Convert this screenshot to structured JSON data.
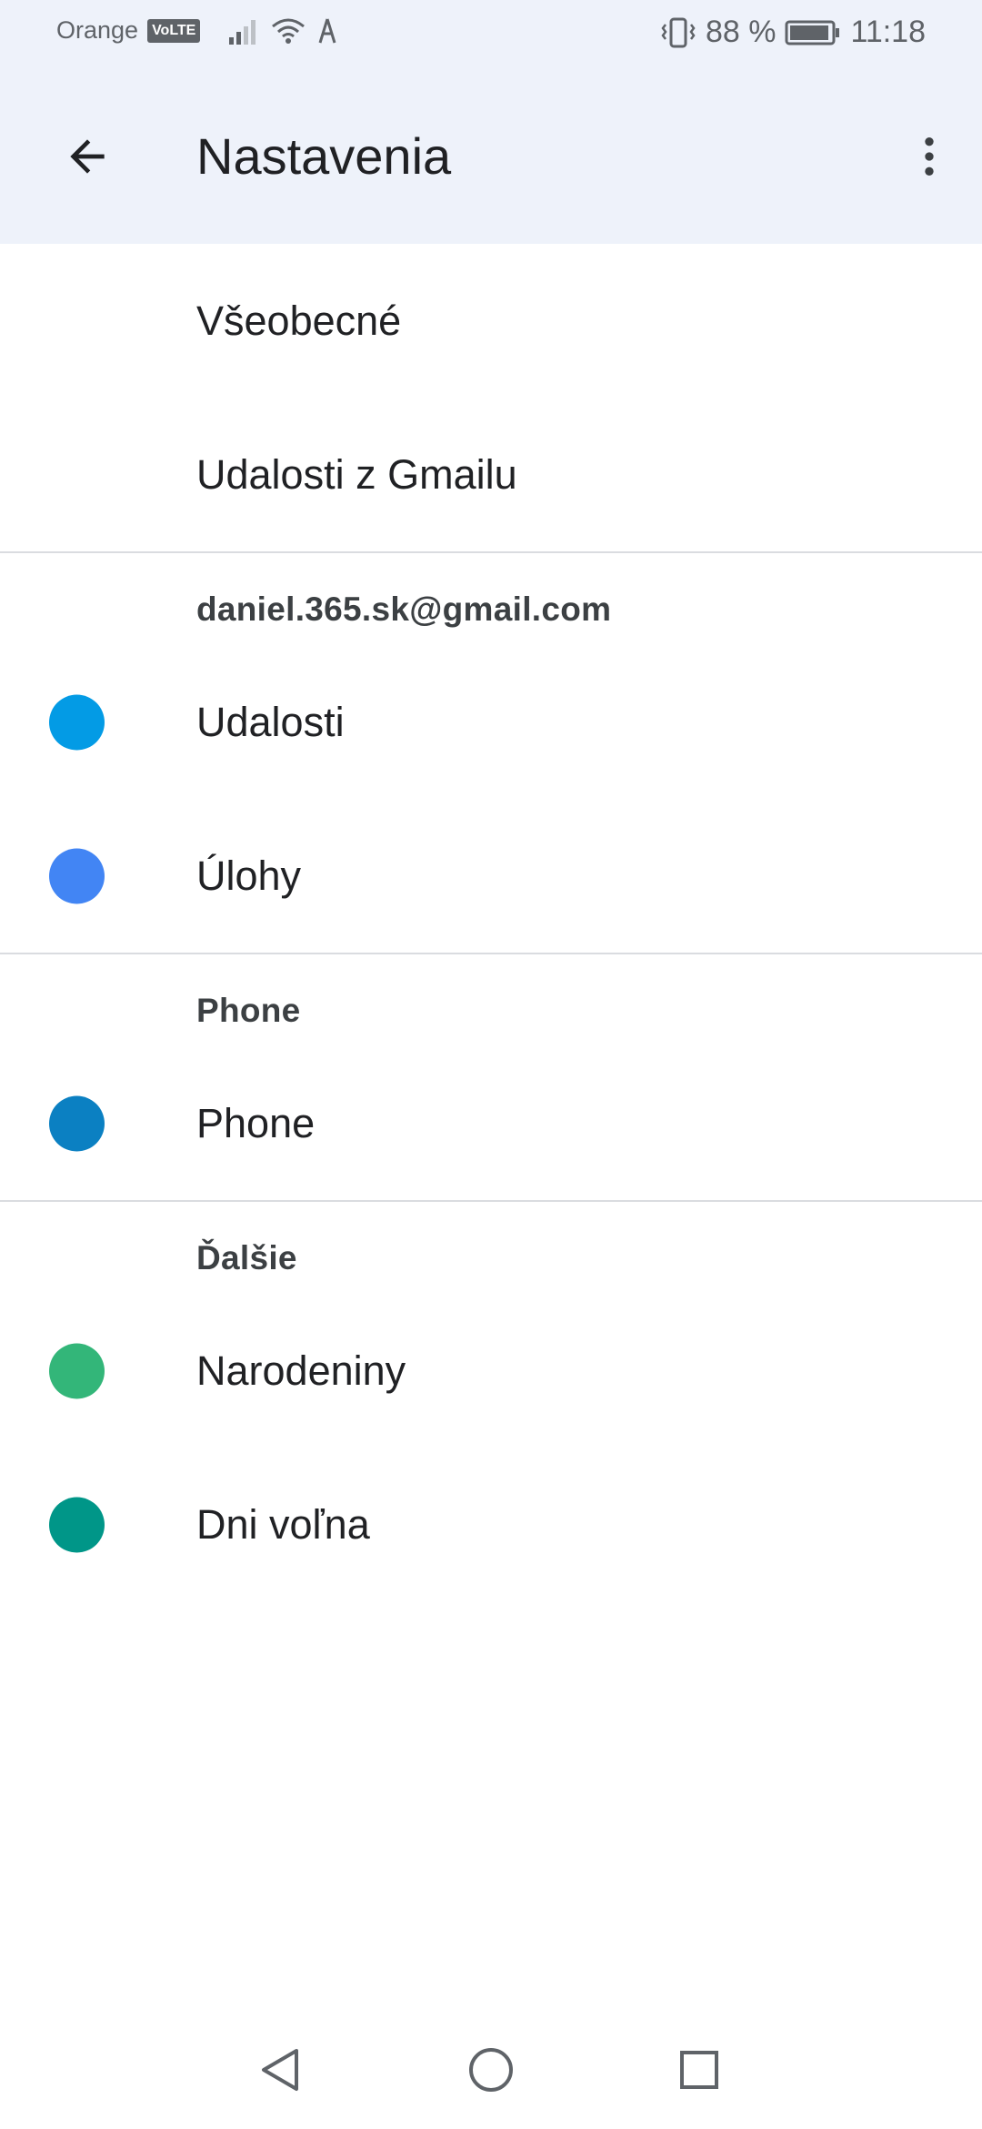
{
  "status": {
    "carrier": "Orange",
    "volte": "VoLTE",
    "battery": "88 %",
    "time": "11:18"
  },
  "appbar": {
    "title": "Nastavenia"
  },
  "general": [
    {
      "label": "Všeobecné"
    },
    {
      "label": "Udalosti z Gmailu"
    }
  ],
  "accounts": [
    {
      "header": "daniel.365.sk@gmail.com",
      "items": [
        {
          "label": "Udalosti",
          "color": "#039be5"
        },
        {
          "label": "Úlohy",
          "color": "#4285f4"
        }
      ]
    },
    {
      "header": "Phone",
      "items": [
        {
          "label": "Phone",
          "color": "#0b80c2"
        }
      ]
    },
    {
      "header": "Ďalšie",
      "items": [
        {
          "label": "Narodeniny",
          "color": "#33b679"
        },
        {
          "label": "Dni voľna",
          "color": "#009688"
        }
      ]
    }
  ]
}
